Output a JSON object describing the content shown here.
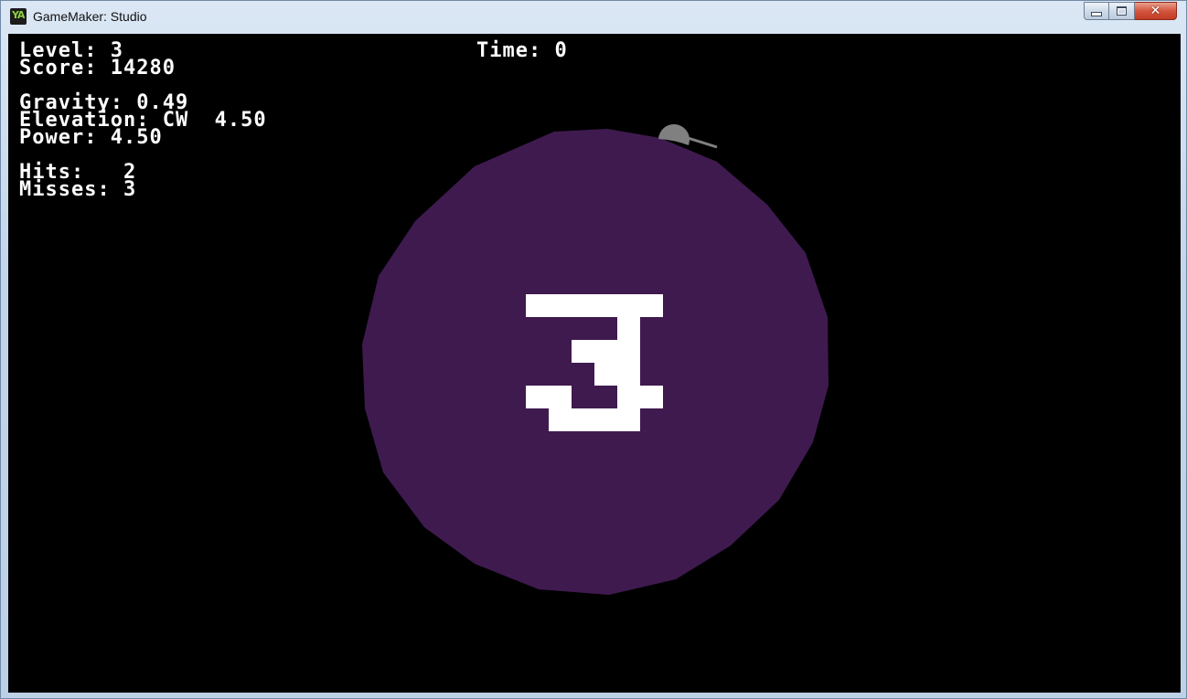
{
  "window": {
    "title": "GameMaker: Studio"
  },
  "icons": {
    "app": "gamemaker-icon",
    "minimize": "minimize-icon",
    "maximize": "maximize-icon",
    "close": "close-icon"
  },
  "app_icon_text": "YA",
  "hud": {
    "level": "Level: 3",
    "score": "Score: 14280",
    "time": "Time: 0",
    "gravity": "Gravity: 0.49",
    "elevation": "Elevation: CW  4.50",
    "power": "Power: 4.50",
    "hits": "Hits:   2",
    "misses": "Misses: 3"
  },
  "planet": {
    "label": "3",
    "color": "#3f1a4f"
  },
  "colors": {
    "background": "#000000",
    "text": "#ffffff",
    "cannon": "#808080"
  }
}
